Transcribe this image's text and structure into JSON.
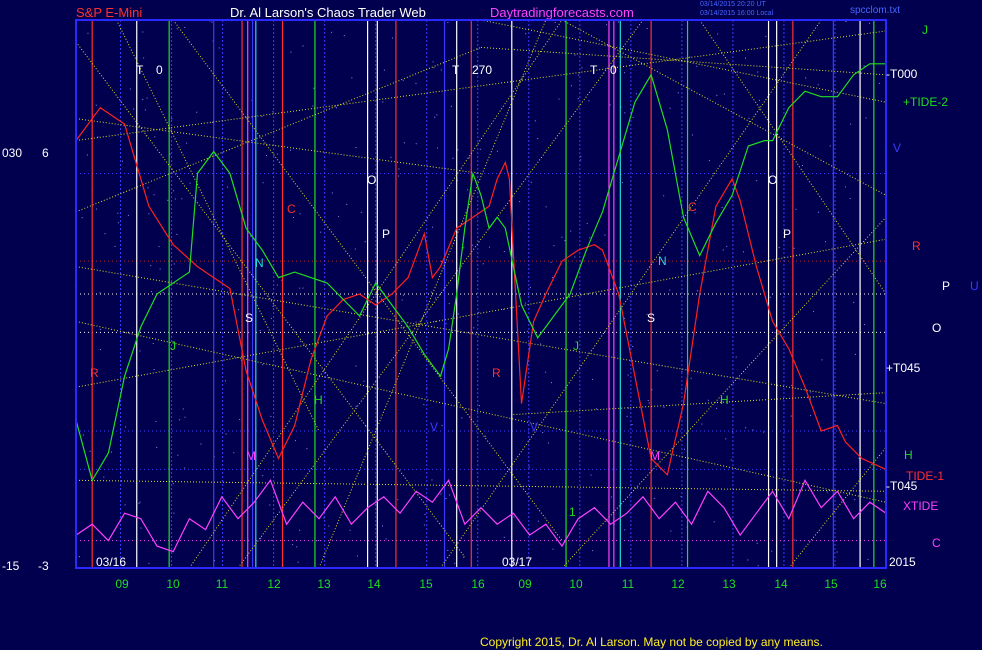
{
  "header": {
    "instrument": "S&P E-Mini",
    "author": "Dr. Al Larson's Chaos Trader Web",
    "site": "Daytradingforecasts.com",
    "timestamp1": "03/14/2015 20:20 UT",
    "timestamp2": "03/14/2015 16:00 Local",
    "filename": "spcclom.txt"
  },
  "footer": {
    "copyright": "Copyright 2015, Dr. Al Larson. May not be copied by any means."
  },
  "colors": {
    "background": "#00004e",
    "plot_border": "#2a2aff",
    "price_line": "#ff2020",
    "tide_line": "#20dd20",
    "xtide_line": "#ff40ff",
    "grid_yellow": "#dddd22",
    "title_red": "#ff3030",
    "title_white": "#ffffff",
    "site_magenta": "#ff44ff"
  },
  "chart_data": {
    "type": "line",
    "x_ticks": [
      "09",
      "10",
      "11",
      "12",
      "13",
      "14",
      "15",
      "16",
      "09",
      "10",
      "11",
      "12",
      "13",
      "14",
      "15",
      "16"
    ],
    "date_labels": [
      "03/16",
      "03/17"
    ],
    "year_label": "2015",
    "left_axis": {
      "top_labels": [
        "030",
        "6"
      ],
      "bottom_labels": [
        "-15",
        "-3"
      ]
    },
    "right_labels": [
      "J",
      "-T000",
      "+TIDE-2",
      "V",
      "R",
      "P",
      "U",
      "O",
      "+T045",
      "H",
      "TIDE-1",
      "-T045",
      "XTIDE",
      "C",
      "2015"
    ],
    "plot_letters": [
      "T",
      "0",
      "T",
      "270",
      "T",
      "0",
      "O",
      "P",
      "C",
      "N",
      "S",
      "J",
      "R",
      "H",
      "M",
      "V",
      "O",
      "P",
      "C",
      "N",
      "S",
      "J",
      "R",
      "H",
      "M",
      "V",
      "1"
    ],
    "series": [
      {
        "name": "price",
        "color": "#ff2020",
        "points": [
          [
            0,
            0.78
          ],
          [
            3,
            0.84
          ],
          [
            6,
            0.81
          ],
          [
            9,
            0.66
          ],
          [
            12,
            0.59
          ],
          [
            15,
            0.55
          ],
          [
            17,
            0.53
          ],
          [
            19,
            0.51
          ],
          [
            21,
            0.36
          ],
          [
            23,
            0.27
          ],
          [
            25,
            0.2
          ],
          [
            27,
            0.26
          ],
          [
            29,
            0.38
          ],
          [
            31,
            0.46
          ],
          [
            33,
            0.49
          ],
          [
            35,
            0.5
          ],
          [
            37,
            0.48
          ],
          [
            39,
            0.5
          ],
          [
            41,
            0.53
          ],
          [
            43,
            0.61
          ],
          [
            44,
            0.53
          ],
          [
            45,
            0.55
          ],
          [
            47,
            0.62
          ],
          [
            49,
            0.64
          ],
          [
            51,
            0.66
          ],
          [
            52,
            0.71
          ],
          [
            53,
            0.74
          ],
          [
            53.5,
            0.71
          ],
          [
            55,
            0.3
          ],
          [
            56.5,
            0.45
          ],
          [
            58,
            0.5
          ],
          [
            60,
            0.56
          ],
          [
            62,
            0.58
          ],
          [
            64,
            0.59
          ],
          [
            65,
            0.58
          ],
          [
            67,
            0.5
          ],
          [
            69,
            0.35
          ],
          [
            71,
            0.2
          ],
          [
            73,
            0.17
          ],
          [
            75,
            0.3
          ],
          [
            77,
            0.5
          ],
          [
            79,
            0.66
          ],
          [
            81,
            0.71
          ],
          [
            82,
            0.67
          ],
          [
            84,
            0.55
          ],
          [
            86,
            0.45
          ],
          [
            88,
            0.4
          ],
          [
            90,
            0.33
          ],
          [
            92,
            0.25
          ],
          [
            94,
            0.26
          ],
          [
            95,
            0.23
          ],
          [
            97,
            0.2
          ],
          [
            100,
            0.18
          ]
        ]
      },
      {
        "name": "tide",
        "color": "#20dd20",
        "points": [
          [
            0,
            0.27
          ],
          [
            2,
            0.16
          ],
          [
            4,
            0.21
          ],
          [
            6,
            0.35
          ],
          [
            8,
            0.44
          ],
          [
            10,
            0.5
          ],
          [
            12,
            0.52
          ],
          [
            14,
            0.54
          ],
          [
            15,
            0.72
          ],
          [
            17,
            0.76
          ],
          [
            19,
            0.72
          ],
          [
            21,
            0.62
          ],
          [
            23,
            0.58
          ],
          [
            25,
            0.53
          ],
          [
            27,
            0.54
          ],
          [
            29,
            0.53
          ],
          [
            31,
            0.52
          ],
          [
            33,
            0.49
          ],
          [
            35,
            0.46
          ],
          [
            37,
            0.52
          ],
          [
            39,
            0.48
          ],
          [
            41,
            0.44
          ],
          [
            43,
            0.39
          ],
          [
            45,
            0.35
          ],
          [
            46,
            0.4
          ],
          [
            47,
            0.5
          ],
          [
            48,
            0.62
          ],
          [
            49,
            0.72
          ],
          [
            50,
            0.68
          ],
          [
            51,
            0.62
          ],
          [
            52,
            0.64
          ],
          [
            53,
            0.62
          ],
          [
            55,
            0.48
          ],
          [
            57,
            0.42
          ],
          [
            59,
            0.46
          ],
          [
            61,
            0.5
          ],
          [
            63,
            0.58
          ],
          [
            65,
            0.65
          ],
          [
            67,
            0.75
          ],
          [
            69,
            0.85
          ],
          [
            71,
            0.9
          ],
          [
            73,
            0.8
          ],
          [
            75,
            0.64
          ],
          [
            77,
            0.57
          ],
          [
            79,
            0.63
          ],
          [
            81,
            0.68
          ],
          [
            83,
            0.77
          ],
          [
            85,
            0.78
          ],
          [
            86,
            0.78
          ],
          [
            88,
            0.84
          ],
          [
            90,
            0.87
          ],
          [
            92,
            0.86
          ],
          [
            94,
            0.86
          ],
          [
            96,
            0.9
          ],
          [
            98,
            0.92
          ],
          [
            100,
            0.92
          ]
        ]
      },
      {
        "name": "xtide",
        "color": "#ff40ff",
        "points": [
          [
            0,
            0.06
          ],
          [
            2,
            0.08
          ],
          [
            4,
            0.05
          ],
          [
            6,
            0.1
          ],
          [
            8,
            0.09
          ],
          [
            10,
            0.04
          ],
          [
            12,
            0.03
          ],
          [
            14,
            0.09
          ],
          [
            16,
            0.07
          ],
          [
            18,
            0.13
          ],
          [
            20,
            0.09
          ],
          [
            22,
            0.12
          ],
          [
            24,
            0.16
          ],
          [
            26,
            0.08
          ],
          [
            28,
            0.12
          ],
          [
            30,
            0.09
          ],
          [
            32,
            0.13
          ],
          [
            34,
            0.08
          ],
          [
            36,
            0.11
          ],
          [
            38,
            0.13
          ],
          [
            40,
            0.1
          ],
          [
            42,
            0.14
          ],
          [
            44,
            0.12
          ],
          [
            46,
            0.16
          ],
          [
            48,
            0.08
          ],
          [
            50,
            0.11
          ],
          [
            52,
            0.08
          ],
          [
            54,
            0.1
          ],
          [
            56,
            0.06
          ],
          [
            58,
            0.08
          ],
          [
            60,
            0.04
          ],
          [
            62,
            0.09
          ],
          [
            64,
            0.11
          ],
          [
            66,
            0.08
          ],
          [
            68,
            0.1
          ],
          [
            70,
            0.13
          ],
          [
            72,
            0.09
          ],
          [
            74,
            0.12
          ],
          [
            76,
            0.08
          ],
          [
            78,
            0.14
          ],
          [
            80,
            0.11
          ],
          [
            82,
            0.06
          ],
          [
            84,
            0.1
          ],
          [
            86,
            0.14
          ],
          [
            88,
            0.09
          ],
          [
            90,
            0.16
          ],
          [
            92,
            0.11
          ],
          [
            94,
            0.14
          ],
          [
            96,
            0.09
          ],
          [
            98,
            0.12
          ],
          [
            100,
            0.1
          ]
        ]
      }
    ]
  }
}
